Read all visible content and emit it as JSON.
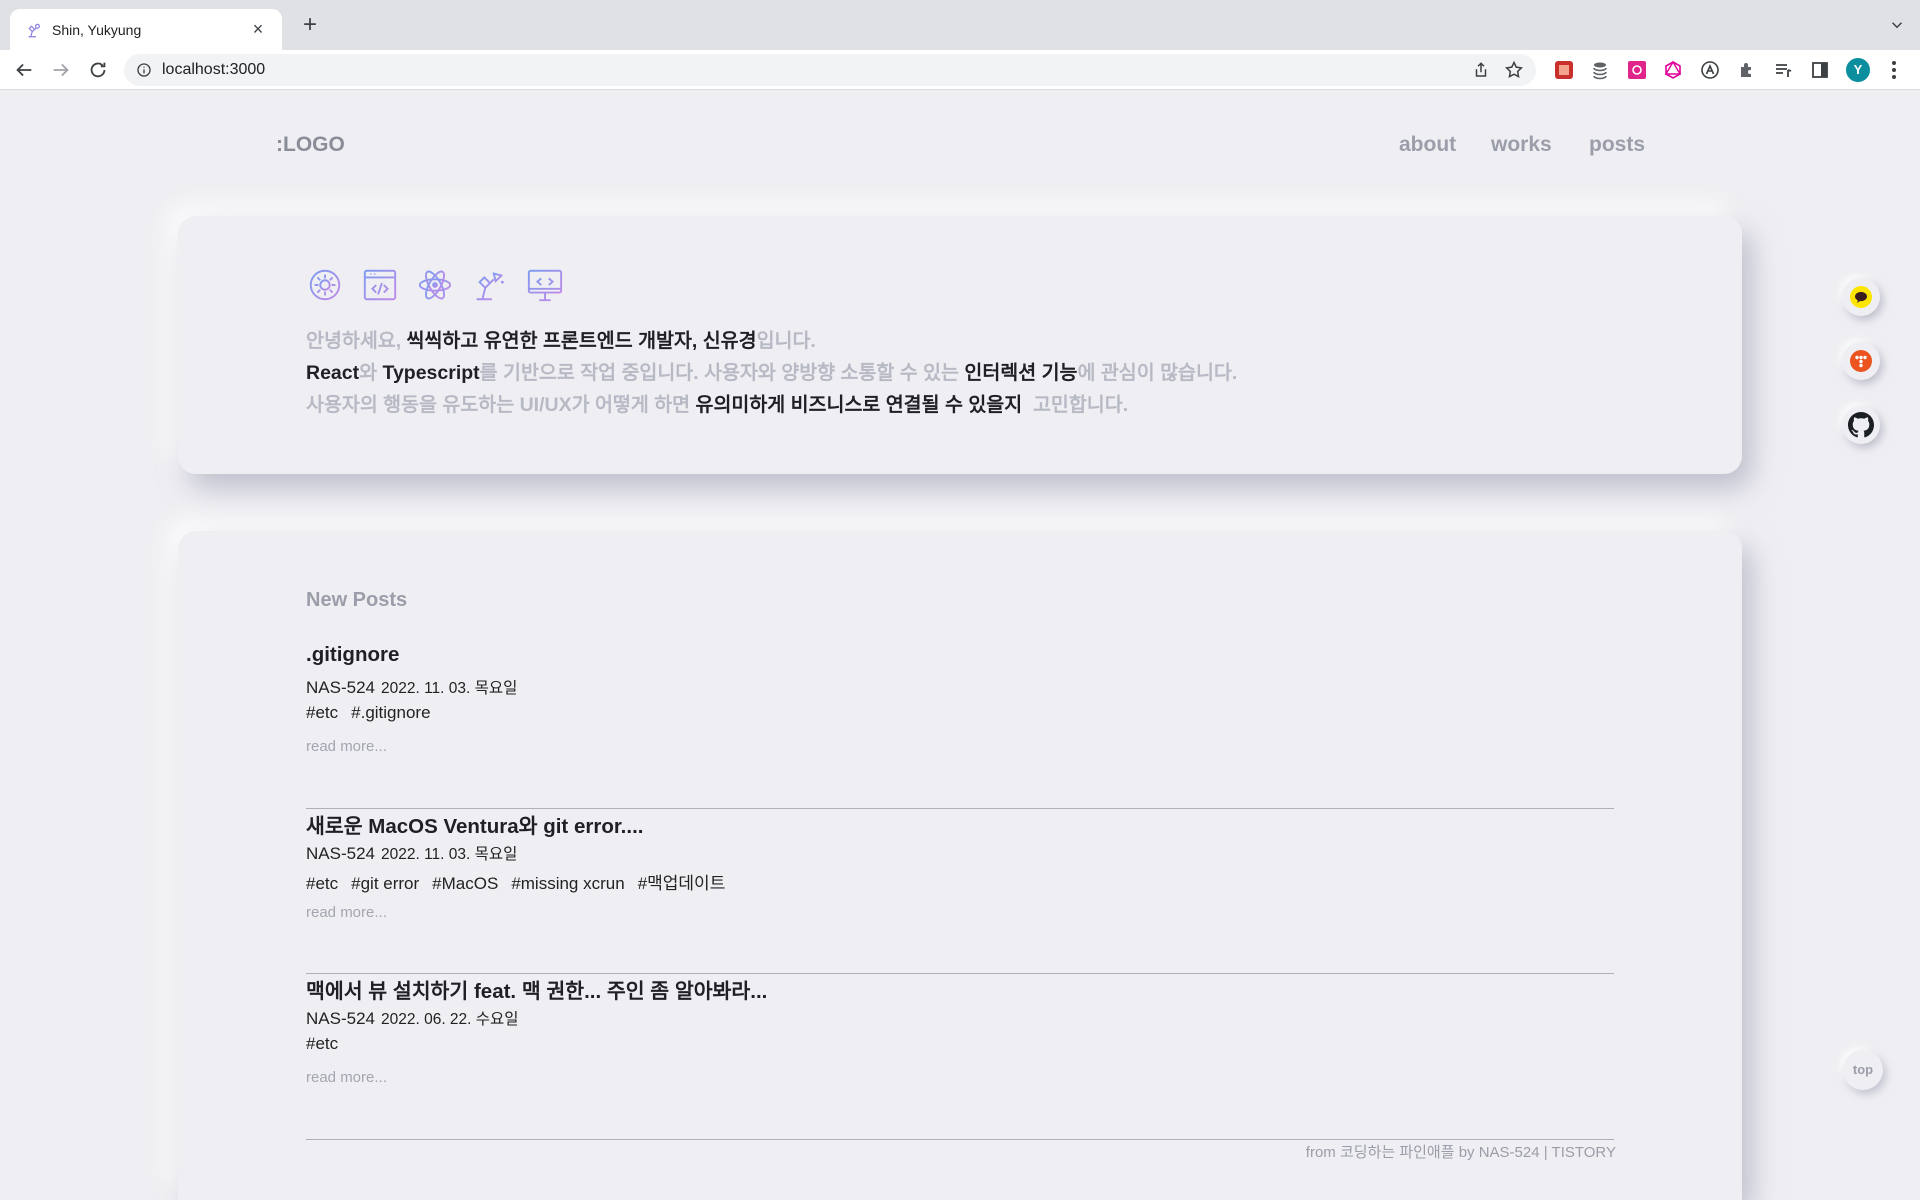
{
  "browser": {
    "tab_title": "Shin, Yukyung",
    "url": "localhost:3000",
    "avatar_letter": "Y"
  },
  "header": {
    "logo": ":LOGO",
    "nav": [
      "about",
      "works",
      "posts"
    ]
  },
  "intro": {
    "line1": [
      {
        "t": "안녕하세요, ",
        "hl": false
      },
      {
        "t": "씩씩하고 유연한 프론트엔드 개발자, 신유경",
        "hl": true
      },
      {
        "t": "입니다.",
        "hl": false
      }
    ],
    "line2": [
      {
        "t": "React",
        "hl": true
      },
      {
        "t": "와 ",
        "hl": false
      },
      {
        "t": "Typescript",
        "hl": true
      },
      {
        "t": "를 기반으로 작업 중입니다. 사용자와 양방향 소통할 수 있는 ",
        "hl": false
      },
      {
        "t": "인터렉션 기능",
        "hl": true
      },
      {
        "t": "에 관심이 많습니다.",
        "hl": false
      }
    ],
    "line3": [
      {
        "t": "사용자의 행동을 유도하는 UI/UX가 어떻게 하면 ",
        "hl": false
      },
      {
        "t": "유의미하게 비즈니스로 연결될 수 있을지",
        "hl": true
      },
      {
        "t": "  고민합니다.",
        "hl": false
      }
    ]
  },
  "posts": {
    "section_title": "New Posts",
    "items": [
      {
        "title": ".gitignore",
        "author": "NAS-524",
        "date": "2022. 11. 03. 목요일",
        "tags": [
          "#etc",
          "#.gitignore"
        ],
        "read_more": "read more..."
      },
      {
        "title": "새로운 MacOS Ventura와 git error....",
        "author": "NAS-524",
        "date": "2022. 11. 03. 목요일",
        "tags": [
          "#etc",
          "#git error",
          "#MacOS",
          "#missing xcrun",
          "#맥업데이트"
        ],
        "read_more": "read more..."
      },
      {
        "title": "맥에서 뷰 설치하기 feat. 맥 권한... 주인 좀 알아봐라...",
        "author": "NAS-524",
        "date": "2022. 06. 22. 수요일",
        "tags": [
          "#etc"
        ],
        "read_more": "read more..."
      }
    ],
    "footer": "from 코딩하는 파인애플 by NAS-524 | TISTORY"
  },
  "floating": {
    "top_label": "top"
  },
  "colors": {
    "background": "#efeff3",
    "muted_text": "#b7b9c4",
    "strong_text": "#1f1f24",
    "kakao": "#fee500",
    "tistory": "#eb531f"
  }
}
